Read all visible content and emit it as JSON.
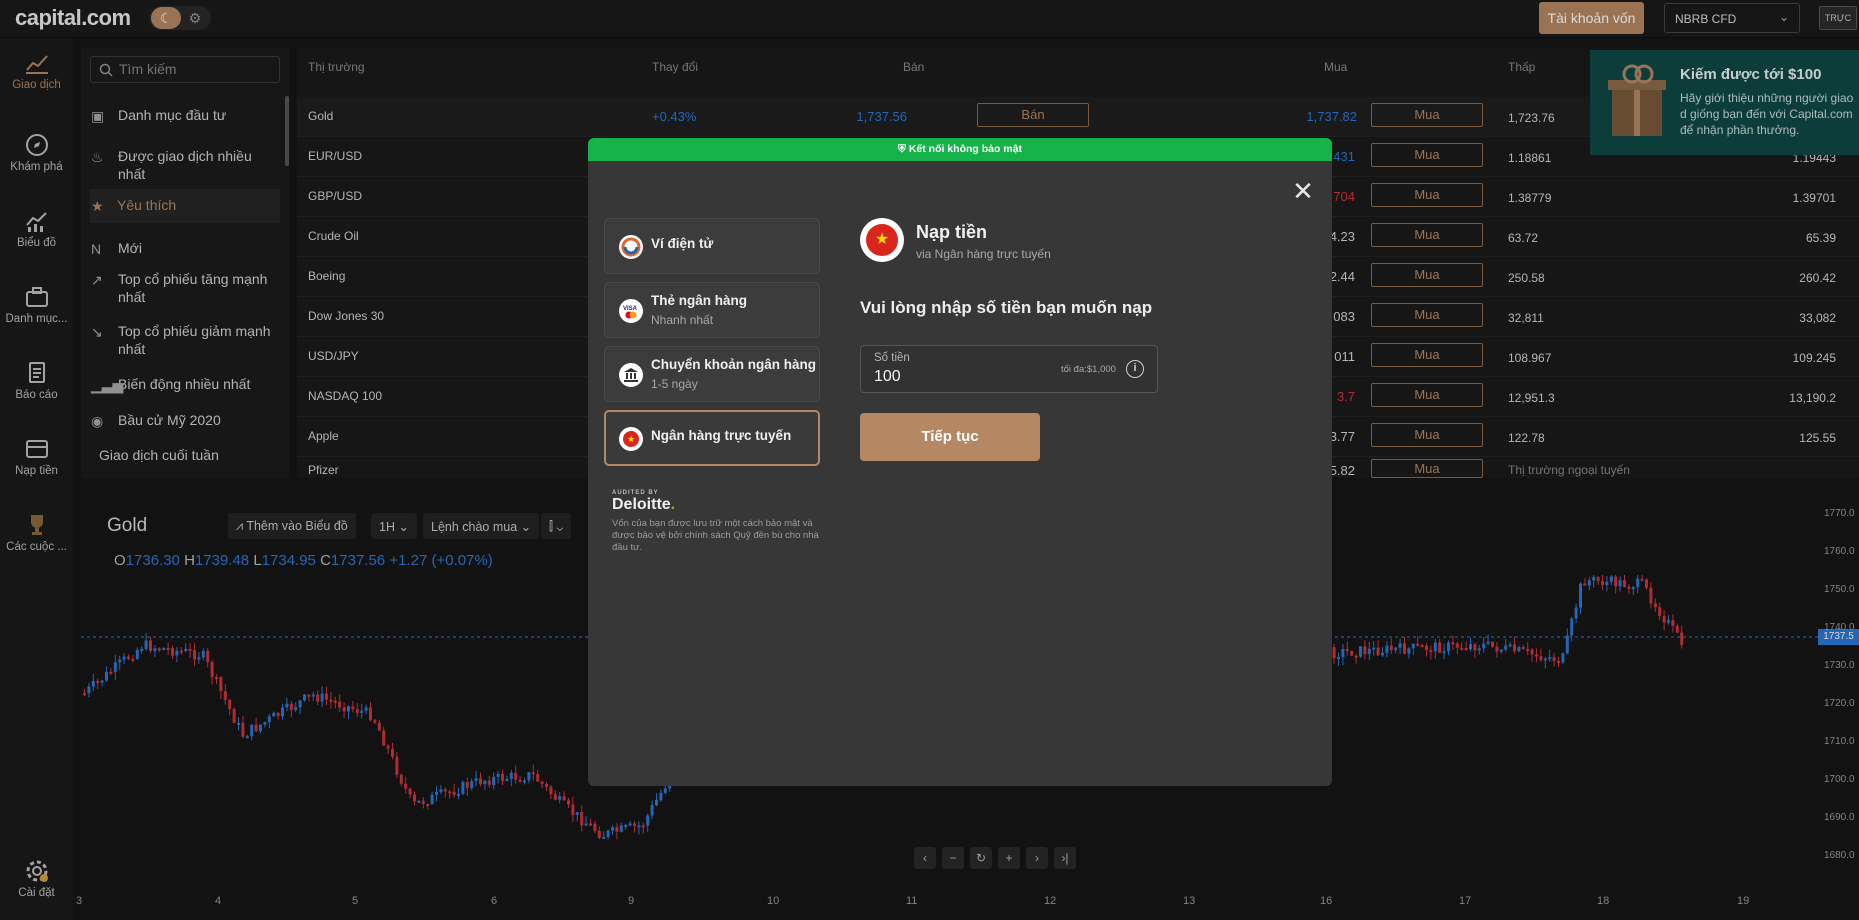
{
  "app": {
    "logo": "capital.com",
    "real_account_button": "Tài khoản vốn",
    "account_type": "NBRB CFD",
    "live_badge": "TRỰC"
  },
  "theme": {
    "moon_glyph": "☾",
    "sun_glyph": "⚙"
  },
  "nav": [
    {
      "label": "Giao dịch"
    },
    {
      "label": "Khám phá"
    },
    {
      "label": "Biểu đồ"
    },
    {
      "label": "Danh mục..."
    },
    {
      "label": "Báo cáo"
    },
    {
      "label": "Nạp tiền"
    },
    {
      "label": "Các cuộc ..."
    }
  ],
  "settings_label": "Cài đặt",
  "sidebar": {
    "search_placeholder": "Tìm kiếm",
    "categories": [
      {
        "label": "Danh mục đầu tư"
      },
      {
        "label": "Được giao dịch nhiều nhất"
      },
      {
        "label": "Yêu thích"
      },
      {
        "label": "Mới"
      },
      {
        "label": "Top cổ phiếu tăng mạnh nhất"
      },
      {
        "label": "Top cổ phiếu giảm mạnh nhất"
      },
      {
        "label": "Biến động nhiều nhất"
      },
      {
        "label": "Bầu cử Mỹ 2020"
      }
    ],
    "weekend": "Giao dịch cuối tuần"
  },
  "market": {
    "headers": {
      "market": "Thị trường",
      "change": "Thay đổi",
      "sell": "Bán",
      "buy": "Mua",
      "low": "Thấp"
    },
    "sell_label": "Bán",
    "buy_label": "Mua",
    "rows": [
      {
        "name": "Gold",
        "change": "+0.43%",
        "sell": "1,737.56",
        "buy": "1,737.82",
        "low": "1,723.76",
        "high": ""
      },
      {
        "name": "EUR/USD",
        "partial_buy": "431",
        "low": "1.18861",
        "high": "1.19443"
      },
      {
        "name": "GBP/USD",
        "partial_buy": "704",
        "low": "1.38779",
        "high": "1.39701"
      },
      {
        "name": "Crude Oil",
        "partial_buy": "4.23",
        "low": "63.72",
        "high": "65.39"
      },
      {
        "name": "Boeing",
        "partial_buy": "2.44",
        "low": "250.58",
        "high": "260.42"
      },
      {
        "name": "Dow Jones 30",
        "partial_buy": "083",
        "low": "32,811",
        "high": "33,082"
      },
      {
        "name": "USD/JPY",
        "partial_buy": "011",
        "low": "108.967",
        "high": "109.245"
      },
      {
        "name": "NASDAQ 100",
        "partial_buy": "3.7",
        "low": "12,951.3",
        "high": "13,190.2"
      },
      {
        "name": "Apple",
        "partial_buy": "3.77",
        "low": "122.78",
        "high": "125.55"
      },
      {
        "name": "Pfizer",
        "partial_buy": "5.82",
        "low": "Thị trường ngoại tuyến",
        "high": ""
      }
    ]
  },
  "referral": {
    "title": "Kiếm được tới $100",
    "body": "Hãy giới thiệu những người giao d giống bạn đến với Capital.com để nhận phần thưởng."
  },
  "chart": {
    "title": "Gold",
    "add_to_chart": "Thêm vào Biểu đồ",
    "timeframe": "1H",
    "order_type": "Lệnh chào mua",
    "ohlc": {
      "o_label": "O",
      "o": "1736.30",
      "h_label": "H",
      "h": "1739.48",
      "l_label": "L",
      "l": "1734.95",
      "c_label": "C",
      "c": "1737.56",
      "delta": "+1.27 (+0.07%)"
    },
    "current_price_tag": "1737.5",
    "x_ticks": [
      "3",
      "4",
      "5",
      "6",
      "9",
      "10",
      "11",
      "12",
      "13",
      "16",
      "17",
      "18",
      "19"
    ],
    "y_ticks": [
      "1770.0",
      "1760.0",
      "1750.0",
      "1740.0",
      "1730.0",
      "1720.0",
      "1710.0",
      "1700.0",
      "1690.0",
      "1680.0"
    ],
    "nav_buttons": [
      "‹",
      "−",
      "↻",
      "+",
      "›",
      "›|"
    ]
  },
  "modal": {
    "secure_banner": "Kết nối không bảo mật",
    "close_glyph": "✕",
    "methods": [
      {
        "title": "Ví điện tử",
        "sub": ""
      },
      {
        "title": "Thẻ ngân hàng",
        "sub": "Nhanh nhất"
      },
      {
        "title": "Chuyển khoản ngân hàng",
        "sub": "1-5 ngày"
      },
      {
        "title": "Ngân hàng trực tuyến",
        "sub": ""
      }
    ],
    "audited_by": "AUDITED BY",
    "deloitte": "Deloitte",
    "deloitte_note": "Vốn của bạn được lưu trữ một cách bảo mật và được bảo vệ bởi chính sách Quỹ đền bù cho nhà đầu tư.",
    "deposit_title": "Nạp tiền",
    "deposit_sub": "via Ngân hàng trực tuyến",
    "prompt": "Vui lòng nhập số tiền bạn muốn nạp",
    "amount_label": "Số tiền",
    "amount_value": "100",
    "amount_max": "tối đa:$1,000",
    "info_glyph": "i",
    "continue_label": "Tiếp tục",
    "flag_star": "★"
  },
  "colors": {
    "accent": "#b58863",
    "secure": "#16b24a",
    "up": "#2b78d6",
    "down": "#d0343a"
  }
}
